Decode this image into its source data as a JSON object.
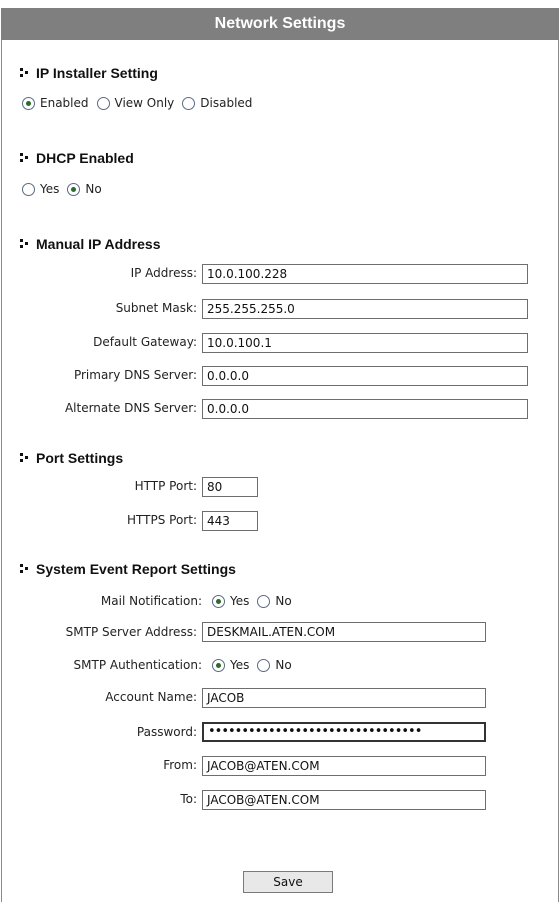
{
  "title": "Network Settings",
  "ip_installer": {
    "heading": "IP Installer Setting",
    "options": [
      "Enabled",
      "View Only",
      "Disabled"
    ],
    "selected": "Enabled"
  },
  "dhcp": {
    "heading": "DHCP Enabled",
    "options": [
      "Yes",
      "No"
    ],
    "selected": "No"
  },
  "manual_ip": {
    "heading": "Manual IP Address",
    "ip_label": "IP Address:",
    "ip_value": "10.0.100.228",
    "subnet_label": "Subnet Mask:",
    "subnet_value": "255.255.255.0",
    "gateway_label": "Default Gateway:",
    "gateway_value": "10.0.100.1",
    "dns1_label": "Primary DNS Server:",
    "dns1_value": "0.0.0.0",
    "dns2_label": "Alternate DNS Server:",
    "dns2_value": "0.0.0.0"
  },
  "ports": {
    "heading": "Port Settings",
    "http_label": "HTTP Port:",
    "http_value": "80",
    "https_label": "HTTPS Port:",
    "https_value": "443"
  },
  "event_report": {
    "heading": "System Event Report Settings",
    "mail_label": "Mail Notification:",
    "mail_options": [
      "Yes",
      "No"
    ],
    "mail_selected": "Yes",
    "smtp_server_label": "SMTP Server Address:",
    "smtp_server_value": "DESKMAIL.ATEN.COM",
    "smtp_auth_label": "SMTP Authentication:",
    "smtp_auth_options": [
      "Yes",
      "No"
    ],
    "smtp_auth_selected": "Yes",
    "account_label": "Account Name:",
    "account_value": "JACOB",
    "password_label": "Password:",
    "password_value": "••••••••••••••••••••••••••••••••",
    "from_label": "From:",
    "from_value": "JACOB@ATEN.COM",
    "to_label": "To:",
    "to_value": "JACOB@ATEN.COM"
  },
  "save_label": "Save"
}
